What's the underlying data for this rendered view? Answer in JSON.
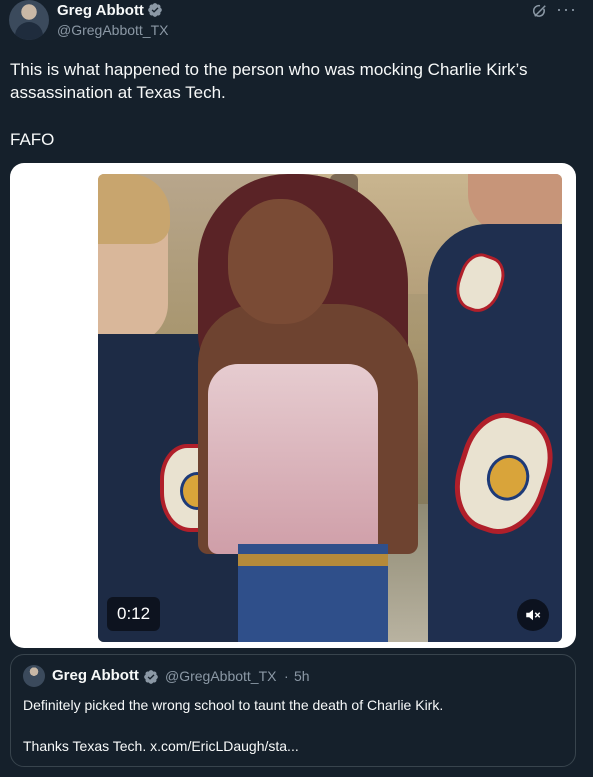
{
  "author": {
    "name": "Greg Abbott",
    "handle": "@GregAbbott_TX"
  },
  "tweet": {
    "text": "This is what happened to the person who was mocking Charlie Kirk’s assassination at Texas Tech.",
    "text2": "FAFO"
  },
  "media": {
    "duration": "0:12",
    "mute_icon": "mute-icon"
  },
  "quote": {
    "name": "Greg Abbott",
    "handle": "@GregAbbott_TX",
    "separator": "·",
    "time": "5h",
    "text": "Definitely picked the wrong school to taunt the death of Charlie Kirk.",
    "text2": "Thanks Texas Tech. x.com/EricLDaugh/sta..."
  },
  "icons": {
    "verified": "verified-badge-icon",
    "grok": "grok-icon",
    "more": "more-icon"
  },
  "colors": {
    "background": "#15202b",
    "text": "#f7f9f9",
    "secondary": "#8b98a5",
    "border": "#38444d",
    "verified": "#1d9bf0"
  }
}
